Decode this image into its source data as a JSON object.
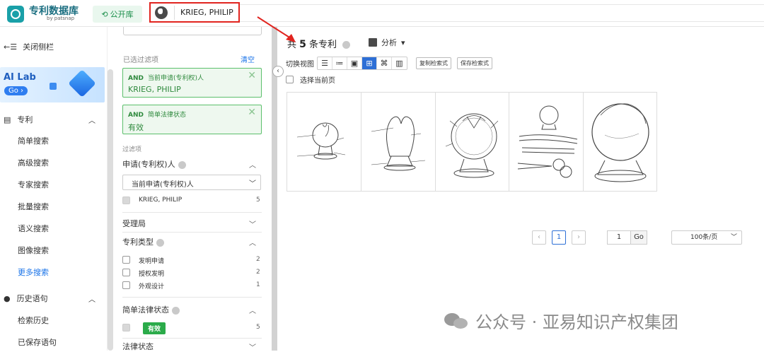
{
  "header": {
    "logo_title": "专利数据库",
    "logo_sub": "by patsnap",
    "public_label": "公开库",
    "search_value": "KRIEG, PHILIP"
  },
  "sidebar": {
    "close_label": "关闭侧栏",
    "ailab": {
      "title": "AI Lab",
      "go": "Go ›"
    },
    "patent_section": "专利",
    "items": [
      "简单搜索",
      "高级搜索",
      "专家搜索",
      "批量搜索",
      "语义搜索",
      "图像搜索",
      "更多搜索"
    ],
    "history_section": "历史语句",
    "history_items": [
      "检索历史",
      "已保存语句"
    ]
  },
  "filters": {
    "applied_title": "已选过滤项",
    "clear_label": "清空",
    "chips": [
      {
        "op": "AND",
        "field": "当前申请(专利权)人",
        "value": "KRIEG, PHILIP",
        "close": "✕"
      },
      {
        "op": "AND",
        "field": "简单法律状态",
        "value": "有效",
        "close": "✕"
      }
    ],
    "filter_title": "过滤项",
    "applicant_group": "申请(专利权)人",
    "applicant_select": "当前申请(专利权)人",
    "applicant_option": {
      "label": "KRIEG, PHILIP",
      "count": "5"
    },
    "office_group": "受理局",
    "type_group": "专利类型",
    "types": [
      {
        "label": "发明申请",
        "count": "2"
      },
      {
        "label": "授权发明",
        "count": "2"
      },
      {
        "label": "外观设计",
        "count": "1"
      }
    ],
    "legal_simple_group": "简单法律状态",
    "legal_simple_option": {
      "label": "有效",
      "count": "5"
    },
    "legal_group": "法律状态"
  },
  "results": {
    "prefix": "共",
    "count": "5",
    "suffix": "条专利",
    "analysis_label": "分析",
    "view_label": "切换视图",
    "copy_query": "复制检索式",
    "save_query": "保存检索式",
    "select_page": "选择当前页"
  },
  "pager": {
    "current": "1",
    "jump_value": "1",
    "go": "Go",
    "per_page": "100条/页"
  },
  "watermark": "公众号 · 亚易知识产权集团"
}
